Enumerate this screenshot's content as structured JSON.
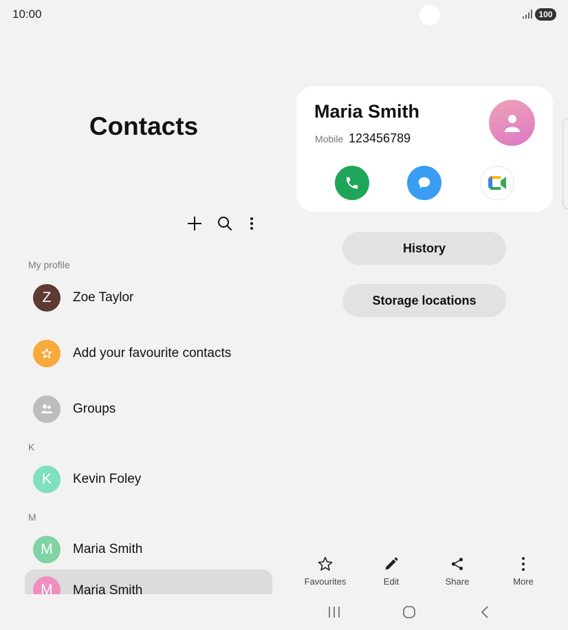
{
  "status_bar": {
    "time": "10:00",
    "battery": "100"
  },
  "page": {
    "title": "Contacts"
  },
  "toolbar": {
    "add_icon": "plus-icon",
    "search_icon": "search-icon",
    "more_icon": "more-vertical-icon"
  },
  "contact_list": {
    "my_profile_label": "My profile",
    "my_profile": {
      "initial": "Z",
      "name": "Zoe Taylor",
      "color": "#5d3a33"
    },
    "favourites": {
      "label": "Add your favourite contacts",
      "icon": "star-icon",
      "color": "#f7a93b"
    },
    "groups": {
      "label": "Groups",
      "icon": "groups-icon",
      "color": "#bdbdbd"
    },
    "sections": [
      {
        "letter": "K",
        "contacts": [
          {
            "initial": "K",
            "name": "Kevin Foley",
            "color": "#7ee0c0"
          }
        ]
      },
      {
        "letter": "M",
        "contacts": [
          {
            "initial": "M",
            "name": "Maria Smith",
            "color": "#7fd3a5"
          },
          {
            "initial": "M",
            "name": "Maria Smith",
            "color": "#ee8fbf",
            "selected": true
          }
        ]
      }
    ]
  },
  "detail": {
    "name": "Maria Smith",
    "phone_label": "Mobile",
    "phone": "123456789",
    "actions": {
      "call_icon": "phone-icon",
      "message_icon": "message-icon",
      "video_icon": "video-call-icon"
    },
    "colors": {
      "call": "#1fa55a",
      "message": "#3a9cf2"
    },
    "buttons": {
      "history": "History",
      "storage": "Storage locations"
    }
  },
  "bottom_actions": [
    {
      "label": "Favourites",
      "icon": "star-outline-icon"
    },
    {
      "label": "Edit",
      "icon": "pencil-icon"
    },
    {
      "label": "Share",
      "icon": "share-icon"
    },
    {
      "label": "More",
      "icon": "more-vertical-icon"
    }
  ],
  "nav_bar": {
    "recents_icon": "recents-icon",
    "home_icon": "home-icon",
    "back_icon": "back-icon"
  }
}
